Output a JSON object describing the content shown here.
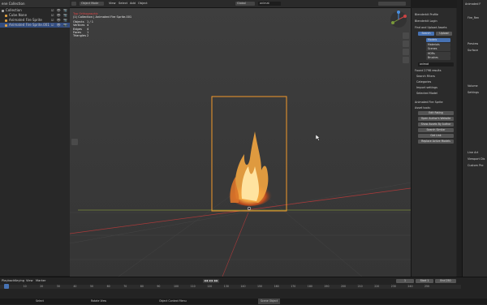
{
  "outliner": {
    "header": "ene Collection",
    "rows": [
      {
        "label": "Collection",
        "color": "#aaaaaa",
        "vis": "☑ 👁 📷"
      },
      {
        "label": "Cube.None",
        "color": "#e0a040",
        "vis": "☑ 👁 📷"
      },
      {
        "label": "Animated Fire Sprite",
        "color": "#e0a040",
        "vis": "☑ 👁 📷"
      },
      {
        "label": "Animated Fire Sprite.001",
        "color": "#e0a040",
        "vis": "☑ 👁 📷",
        "selected": true
      }
    ]
  },
  "viewport": {
    "mode": "Object Mode",
    "menus": [
      "View",
      "Select",
      "Add",
      "Object"
    ],
    "orientation": "Global",
    "search": "animat",
    "view_name": "Top Orthographic",
    "collection": "(1) Collection | Animated Fire Sprite.001",
    "stats": [
      {
        "k": "Objects",
        "v": "1 / 1"
      },
      {
        "k": "Vertices",
        "v": "4"
      },
      {
        "k": "Edges",
        "v": "4"
      },
      {
        "k": "Faces",
        "v": "1"
      },
      {
        "k": "Triangles",
        "v": "2"
      }
    ]
  },
  "npanel": {
    "blenderkit_rows": [
      "Blenderkit Profile",
      "Blenderkit Login"
    ],
    "find_row": "Find and Upload Assets",
    "tabs": [
      "Search",
      "Upload"
    ],
    "categories": [
      "Models",
      "Materials",
      "Scenes",
      "HDRs",
      "Brushes"
    ],
    "search_value": "animat",
    "found": "Found 2798 results",
    "sections": [
      "Search Filters",
      "Categories",
      "Import settings",
      "Selected Model"
    ],
    "model_name": "Animated Fire Sprite",
    "asset_tools": "Asset tools:",
    "buttons": [
      "Edit Rating",
      "Open Author's Website",
      "Show Assets By Author",
      "Search Similar",
      "Get Link",
      "Replace Active Models"
    ]
  },
  "props": {
    "title": "Animated F",
    "rows": [
      "Fire_Ren",
      "Preview",
      "Surface",
      "Volume",
      "Settings",
      "Line Art",
      "Viewport Dis",
      "Custom Pro"
    ]
  },
  "timeline": {
    "menus": [
      "Playback",
      "Keying",
      "View",
      "Marker"
    ],
    "current_frame": "1",
    "start_label": "Start",
    "start": "1",
    "end_label": "End",
    "end": "250",
    "ticks": [
      "0",
      "10",
      "20",
      "30",
      "40",
      "50",
      "60",
      "70",
      "80",
      "90",
      "100",
      "110",
      "120",
      "130",
      "140",
      "150",
      "160",
      "170",
      "180",
      "190",
      "200",
      "210",
      "220",
      "230",
      "240",
      "250"
    ]
  },
  "statusbar": {
    "left": "Select",
    "middle": "Rotate View",
    "right": "Object Context Menu",
    "far": "Scene Object"
  },
  "colors": {
    "accent": "#4772b3",
    "selection": "#f39a2b",
    "axis_red": "#a83a3a",
    "axis_green": "#7a8a3a"
  }
}
